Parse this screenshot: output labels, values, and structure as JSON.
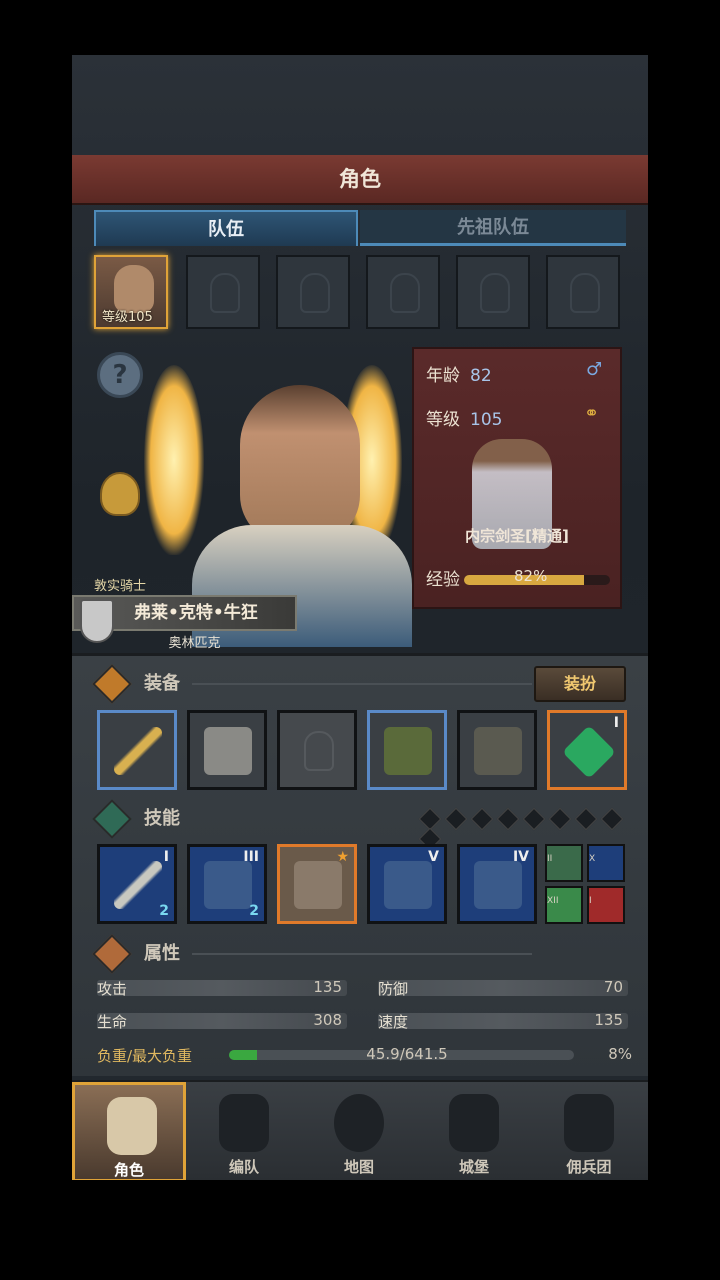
{
  "header": {
    "title": "角色"
  },
  "tabs": [
    {
      "label": "队伍"
    },
    {
      "label": "先祖队伍"
    }
  ],
  "team": {
    "active_level_label": "等级105"
  },
  "hero": {
    "rank_title": "敦实骑士",
    "name": "弗莱•克特•牛狂",
    "origin": "奥林匹克"
  },
  "card": {
    "age_label": "年龄",
    "age": "82",
    "level_label": "等级",
    "level": "105",
    "class_name": "内宗剑圣[精通]",
    "exp_label": "经验",
    "exp_percent": "82%",
    "exp_fraction": 0.82,
    "gender_icon": "male-icon",
    "marriage_icon": "rings-icon"
  },
  "equipment": {
    "label": "装备",
    "dress_button": "装扮",
    "slots": [
      "sword",
      "gauntlet",
      "empty-helmet",
      "fur-armor",
      "boots",
      "green-gem"
    ],
    "gem_roman": "I"
  },
  "skills": {
    "label": "技能",
    "items": [
      {
        "roman": "I",
        "badge": "2"
      },
      {
        "roman": "III",
        "badge": "2"
      },
      {
        "roman": "",
        "badge": ""
      },
      {
        "roman": "V",
        "badge": ""
      },
      {
        "roman": "IV",
        "badge": ""
      }
    ],
    "small": [
      "II",
      "X",
      "XII",
      "I"
    ]
  },
  "attributes": {
    "label": "属性",
    "attack_label": "攻击",
    "attack": "135",
    "defense_label": "防御",
    "defense": "70",
    "hp_label": "生命",
    "hp": "308",
    "speed_label": "速度",
    "speed": "135",
    "load_label": "负重/最大负重",
    "load": "45.9/641.5",
    "load_percent": "8%",
    "load_fraction": 0.08
  },
  "nav": [
    {
      "label": "角色"
    },
    {
      "label": "编队"
    },
    {
      "label": "地图"
    },
    {
      "label": "城堡"
    },
    {
      "label": "佣兵团"
    }
  ],
  "colors": {
    "accent": "#e0a338",
    "tab_blue": "#4d8ab8",
    "banner_red": "#5a2a2a"
  }
}
